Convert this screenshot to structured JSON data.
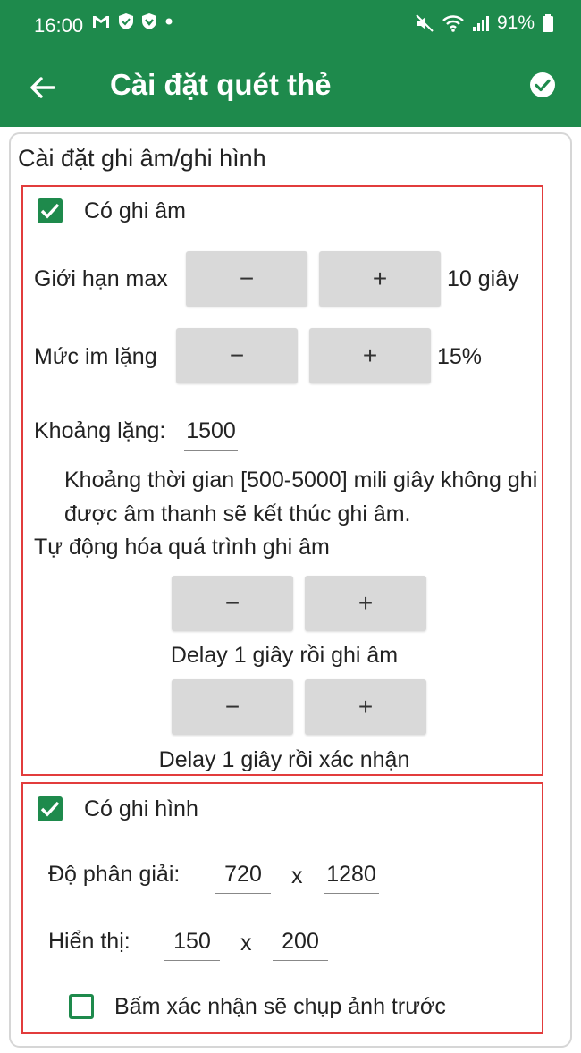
{
  "status_bar": {
    "time": "16:00",
    "battery": "91%",
    "icons_left": [
      "gmail-icon",
      "shield-icon",
      "vpn-icon",
      "dot-icon"
    ],
    "icons_right": [
      "mute-icon",
      "wifi-icon",
      "signal-icon",
      "battery-icon"
    ]
  },
  "app_bar": {
    "title": "Cài đặt quét thẻ",
    "color": "#1e8a4c"
  },
  "card": {
    "title": "Cài đặt ghi âm/ghi hình"
  },
  "audio": {
    "enabled": true,
    "checkbox_label": "Có ghi âm",
    "max_limit": {
      "label": "Giới hạn max",
      "minus": "−",
      "plus": "+",
      "value": "10 giây"
    },
    "silence_level": {
      "label": "Mức im lặng",
      "minus": "−",
      "plus": "+",
      "value": "15%"
    },
    "silence_gap": {
      "label": "Khoảng lặng:",
      "value": "1500"
    },
    "help_text": "Khoảng thời gian [500-5000] mili giây không ghi được âm thanh sẽ kết thúc ghi âm.",
    "automation_title": "Tự động hóa quá trình ghi âm",
    "delay_record": {
      "minus": "−",
      "plus": "+",
      "caption": "Delay 1 giây rồi ghi âm"
    },
    "delay_confirm": {
      "minus": "−",
      "plus": "+",
      "caption": "Delay 1 giây rồi xác nhận"
    }
  },
  "video": {
    "enabled": true,
    "checkbox_label": "Có ghi hình",
    "resolution": {
      "label": "Độ phân giải:",
      "width": "720",
      "sep": "x",
      "height": "1280"
    },
    "display": {
      "label": "Hiển thị:",
      "width": "150",
      "sep": "x",
      "height": "200"
    },
    "photo_first": {
      "checked": false,
      "label": "Bấm xác nhận sẽ chụp ảnh trước"
    }
  }
}
